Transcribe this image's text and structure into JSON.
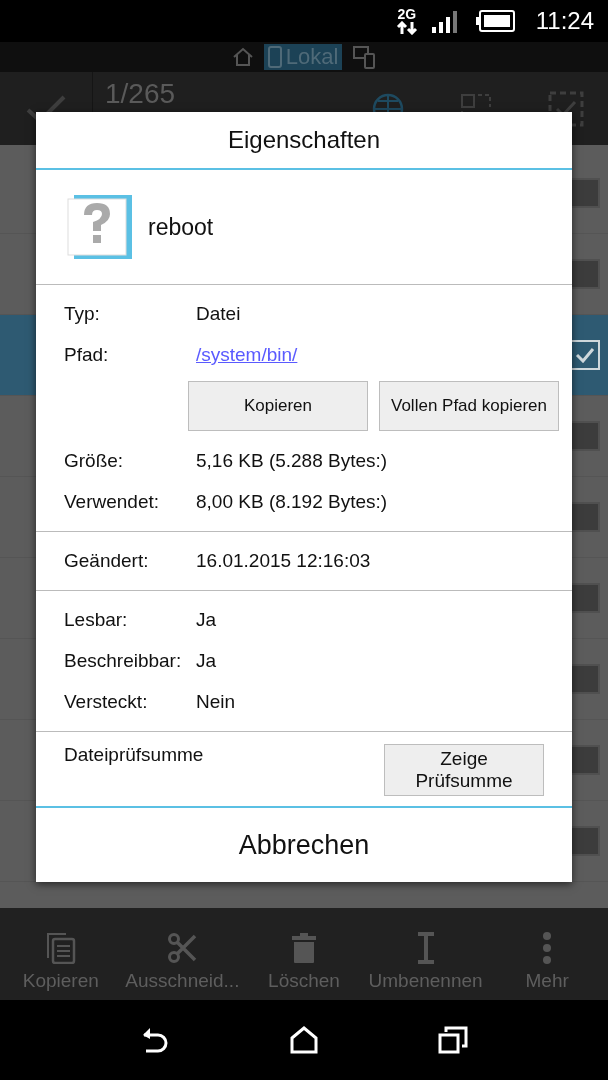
{
  "status_bar": {
    "network": "2G",
    "time": "11:24"
  },
  "location_bar": {
    "tabs": [
      {
        "kind": "home",
        "selected": false
      },
      {
        "kind": "local",
        "label": "Lokal",
        "selected": true
      },
      {
        "kind": "devices",
        "selected": false
      }
    ]
  },
  "toolbar": {
    "counter": "1/265"
  },
  "file_list": [
    {
      "selected": false
    },
    {
      "selected": false
    },
    {
      "selected": true
    },
    {
      "selected": false
    },
    {
      "selected": false
    },
    {
      "selected": false
    },
    {
      "selected": false
    },
    {
      "selected": false
    },
    {
      "selected": false
    }
  ],
  "dialog": {
    "title": "Eigenschaften",
    "file_name": "reboot",
    "sections": [
      {
        "rows": [
          {
            "kind": "text",
            "label": "Typ:",
            "value": "Datei"
          },
          {
            "kind": "link",
            "label": "Pfad:",
            "value": "/system/bin/"
          },
          {
            "kind": "buttons",
            "buttons": [
              "Kopieren",
              "Vollen Pfad kopieren"
            ]
          },
          {
            "kind": "text",
            "label": "Größe:",
            "value": "5,16 KB (5.288 Bytes:)"
          },
          {
            "kind": "text",
            "label": "Verwendet:",
            "value": "8,00 KB (8.192 Bytes:)"
          }
        ]
      },
      {
        "rows": [
          {
            "kind": "text",
            "label": "Geändert:",
            "value": "16.01.2015 12:16:03"
          }
        ]
      },
      {
        "rows": [
          {
            "kind": "text",
            "label": "Lesbar:",
            "value": "Ja"
          },
          {
            "kind": "text",
            "label": "Beschreibbar:",
            "value": "Ja"
          },
          {
            "kind": "text",
            "label": "Versteckt:",
            "value": "Nein"
          }
        ]
      }
    ],
    "checksum": {
      "label": "Dateiprüfsumme",
      "button": "Zeige Prüfsumme"
    },
    "cancel": "Abbrechen"
  },
  "bottom_bar": [
    {
      "kind": "copy",
      "label": "Kopieren"
    },
    {
      "kind": "cut",
      "label": "Ausschneid..."
    },
    {
      "kind": "delete",
      "label": "Löschen"
    },
    {
      "kind": "rename",
      "label": "Umbenennen"
    },
    {
      "kind": "more",
      "label": "Mehr"
    }
  ]
}
